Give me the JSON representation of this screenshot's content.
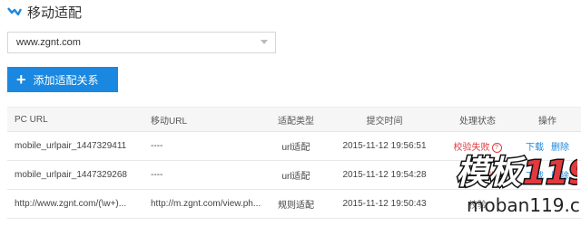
{
  "section": {
    "title": "移动适配",
    "icon": "chevron-down-icon"
  },
  "domain_select": {
    "value": "www.zgnt.com"
  },
  "add_button": {
    "label": "添加适配关系",
    "icon": "plus-icon"
  },
  "table": {
    "headers": [
      "PC URL",
      "移动URL",
      "适配类型",
      "提交时间",
      "处理状态",
      "操作"
    ],
    "rows": [
      {
        "pc_url": "mobile_urlpair_1447329411",
        "mobile_url": "----",
        "type": "url适配",
        "time": "2015-11-12 19:56:51",
        "status": "校验失败",
        "status_color": "#e0393e",
        "ops": [
          "下载",
          "删除"
        ]
      },
      {
        "pc_url": "mobile_urlpair_1447329268",
        "mobile_url": "----",
        "type": "url适配",
        "time": "2015-11-12 19:54:28",
        "status": "校验失败",
        "status_color": "#e0393e",
        "ops": [
          "下载",
          "删除"
        ]
      },
      {
        "pc_url": "http://www.zgnt.com/(\\w+)...",
        "mobile_url": "http://m.zgnt.com/view.ph...",
        "type": "规则适配",
        "time": "2015-11-12 19:50:43",
        "status": "校验",
        "status_color": "#666666",
        "ops": []
      }
    ]
  },
  "watermark": {
    "logo_text": "模板119",
    "url_text": "moban119.com"
  },
  "colors": {
    "accent": "#1a88e0",
    "error": "#e0393e"
  }
}
